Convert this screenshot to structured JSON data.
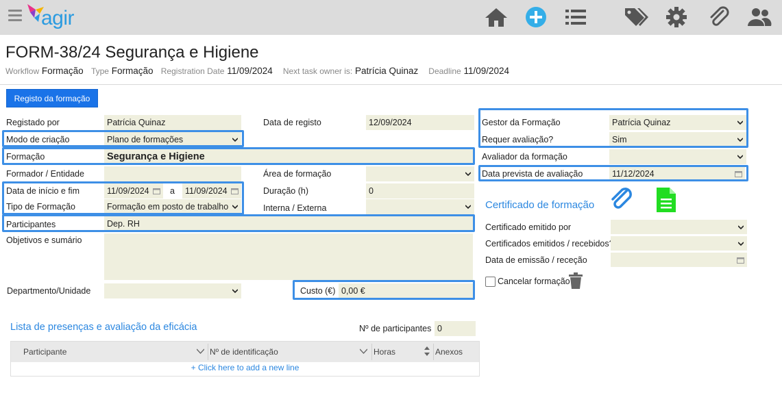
{
  "app": {
    "logo_text": "agir"
  },
  "toolbar_icons": [
    "home-icon",
    "add-icon",
    "list-icon",
    "tags-icon",
    "gear-icon",
    "paperclip-icon",
    "users-icon"
  ],
  "colors": {
    "topbar": "#dcdcdc",
    "accent": "#1a73e8",
    "field_bg": "#efefde",
    "highlight": "#3d8fe6",
    "link": "#2b87e0"
  },
  "header": {
    "title": "FORM-38/24 Segurança e Higiene",
    "workflow_label": "Workflow",
    "workflow_value": "Formação",
    "type_label": "Type",
    "type_value": "Formação",
    "regdate_label": "Registration Date",
    "regdate_value": "11/09/2024",
    "owner_label": "Next task owner is:",
    "owner_value": "Patrícia Quinaz",
    "deadline_label": "Deadline",
    "deadline_value": "11/09/2024"
  },
  "tab_button": "Registo da formação",
  "form": {
    "registado_por_label": "Registado por",
    "registado_por_value": "Patrícia Quinaz",
    "data_registo_label": "Data de registo",
    "data_registo_value": "12/09/2024",
    "modo_label": "Modo de criação",
    "modo_value": "Plano de formações",
    "formacao_label": "Formação",
    "formacao_value": "Segurança e Higiene",
    "formador_label": "Formador / Entidade",
    "formador_value": "",
    "area_label": "Área de formação",
    "area_value": "",
    "datas_label": "Data de início e fim",
    "data_inicio": "11/09/2024",
    "data_a": "a",
    "data_fim": "11/09/2024",
    "duracao_label": "Duração (h)",
    "duracao_value": "0",
    "tipo_label": "Tipo de Formação",
    "tipo_value": "Formação em posto de trabalho",
    "interna_label": "Interna / Externa",
    "interna_value": "",
    "participantes_label": "Participantes",
    "participantes_value": "Dep. RH",
    "objetivos_label": "Objetivos e sumário",
    "objetivos_value": "",
    "departamento_label": "Departmento/Unidade",
    "departamento_value": "",
    "custo_label": "Custo (€)",
    "custo_value": "0,00 €"
  },
  "right": {
    "gestor_label": "Gestor da Formação",
    "gestor_value": "Patrícia Quinaz",
    "requer_label": "Requer avaliação?",
    "requer_value": "Sim",
    "avaliador_label": "Avaliador da formação",
    "avaliador_value": "",
    "data_prevista_label": "Data prevista de avaliação",
    "data_prevista_value": "11/12/2024",
    "cert_title": "Certificado de formação",
    "cert_emitido_label": "Certificado emitido por",
    "cert_emitido_value": "",
    "cert_recebidos_label": "Certificados emitidos / recebidos?",
    "cert_recebidos_value": "",
    "cert_data_label": "Data de emissão / receção",
    "cert_data_value": "",
    "cancelar_label": "Cancelar formação"
  },
  "list": {
    "title": "Lista de presenças e avaliação da eficácia",
    "num_label": "Nº de participantes",
    "num_value": "0",
    "columns": [
      "Participante",
      "Nº de identificação",
      "Horas",
      "Anexos"
    ],
    "add_line": "+ Click here to add a new line"
  }
}
